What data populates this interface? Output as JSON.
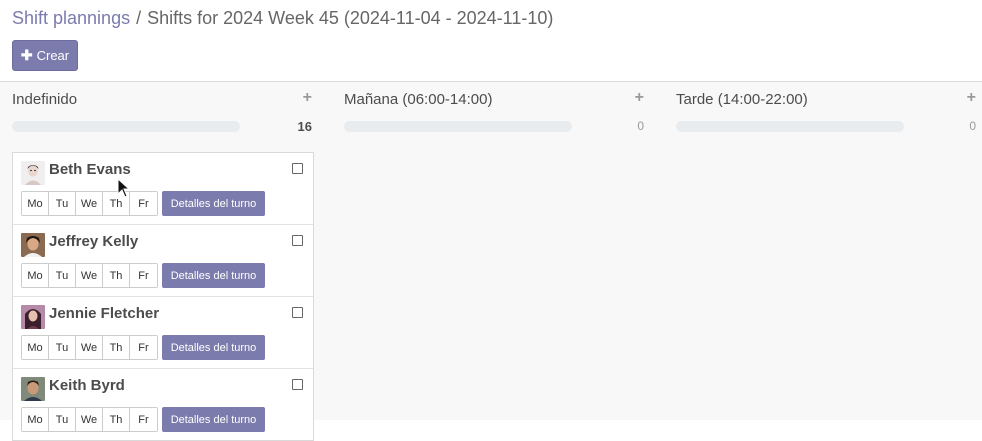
{
  "breadcrumb": {
    "parent": "Shift plannings",
    "separator": "/",
    "current": "Shifts for 2024 Week 45 (2024-11-04 - 2024-11-10)"
  },
  "toolbar": {
    "create_label": "Crear",
    "create_icon": "plus-icon"
  },
  "columns": [
    {
      "title": "Indefinido",
      "count": "16",
      "progress": 0.0
    },
    {
      "title": "Mañana (06:00-14:00)",
      "count": "0",
      "progress": 0.0
    },
    {
      "title": "Tarde (14:00-22:00)",
      "count": "0",
      "progress": 0.0
    }
  ],
  "add_icon": "+",
  "days": [
    "Mo",
    "Tu",
    "We",
    "Th",
    "Fr"
  ],
  "details_label": "Detalles del turno",
  "cards": [
    {
      "name": "Beth Evans"
    },
    {
      "name": "Jeffrey Kelly"
    },
    {
      "name": "Jennie Fletcher"
    },
    {
      "name": "Keith Byrd"
    }
  ],
  "colors": {
    "primary": "#7c7bad",
    "progress_track": "#e9ecef"
  }
}
